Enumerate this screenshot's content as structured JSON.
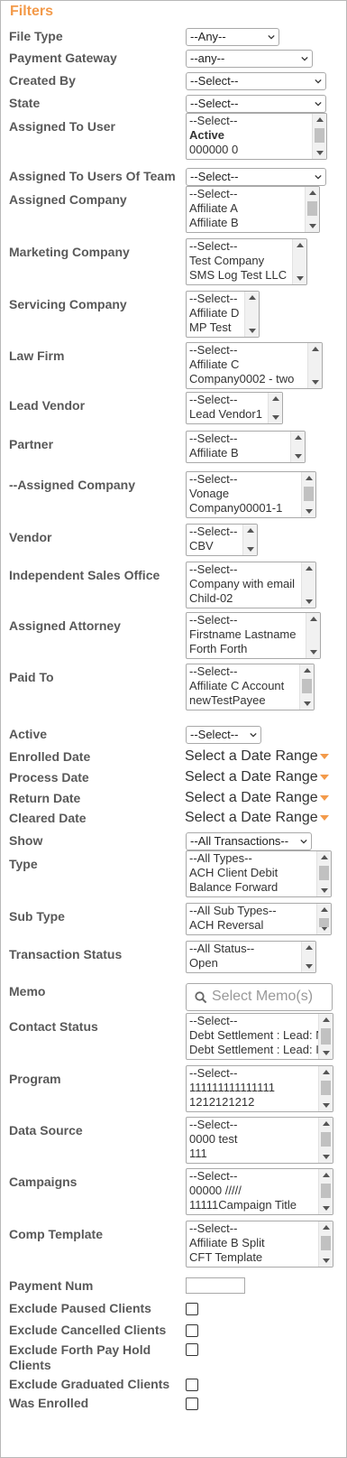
{
  "title": "Filters",
  "file_type": {
    "label": "File Type",
    "value": "--Any--"
  },
  "payment_gateway": {
    "label": "Payment Gateway",
    "value": "--any--"
  },
  "created_by": {
    "label": "Created By",
    "value": "--Select--"
  },
  "state": {
    "label": "State",
    "value": "--Select--"
  },
  "assigned_to_user": {
    "label": "Assigned To User",
    "options": [
      "--Select--",
      "Active",
      "000000  0"
    ]
  },
  "assigned_to_users_of_team": {
    "label": "Assigned To Users Of Team",
    "value": "--Select--"
  },
  "assigned_company": {
    "label": "Assigned Company",
    "options": [
      "--Select--",
      "Affiliate A",
      "Affiliate B"
    ]
  },
  "marketing_company": {
    "label": "Marketing Company",
    "options": [
      "--Select--",
      "Test Company",
      "SMS Log Test LLC"
    ]
  },
  "servicing_company": {
    "label": "Servicing Company",
    "options": [
      "--Select--",
      "Affiliate D",
      "MP Test"
    ]
  },
  "law_firm": {
    "label": "Law Firm",
    "options": [
      "--Select--",
      "Affiliate C",
      "Company0002 - two"
    ]
  },
  "lead_vendor": {
    "label": "Lead Vendor",
    "options": [
      "--Select--",
      "Lead Vendor1"
    ]
  },
  "partner": {
    "label": "Partner",
    "options": [
      "--Select--",
      "Affiliate B"
    ]
  },
  "assigned_company_2": {
    "label": "--Assigned Company",
    "options": [
      "--Select--",
      "Vonage",
      "Company00001-1"
    ]
  },
  "vendor": {
    "label": "Vendor",
    "options": [
      "--Select--",
      "CBV"
    ]
  },
  "independent_sales_office": {
    "label": "Independent Sales Office",
    "options": [
      "--Select--",
      "Company with email",
      "Child-02"
    ]
  },
  "assigned_attorney": {
    "label": "Assigned Attorney",
    "options": [
      "--Select--",
      "Firstname Lastname",
      "Forth Forth"
    ]
  },
  "paid_to": {
    "label": "Paid To",
    "options": [
      "--Select--",
      "Affiliate C Account",
      "newTestPayee"
    ]
  },
  "active": {
    "label": "Active",
    "value": "--Select--"
  },
  "enrolled_date": {
    "label": "Enrolled Date",
    "value": "Select a Date Range"
  },
  "process_date": {
    "label": "Process Date",
    "value": "Select a Date Range"
  },
  "return_date": {
    "label": "Return Date",
    "value": "Select a Date Range"
  },
  "cleared_date": {
    "label": "Cleared Date",
    "value": "Select a Date Range"
  },
  "show": {
    "label": "Show",
    "value": "--All Transactions--"
  },
  "type": {
    "label": "Type",
    "options": [
      "--All Types--",
      "ACH Client Debit",
      "Balance Forward"
    ]
  },
  "sub_type": {
    "label": "Sub Type",
    "options": [
      "--All Sub Types--",
      "ACH Reversal"
    ]
  },
  "transaction_status": {
    "label": "Transaction Status",
    "options": [
      "--All Status--",
      "Open"
    ]
  },
  "memo": {
    "label": "Memo",
    "placeholder": "Select Memo(s)"
  },
  "contact_status": {
    "label": "Contact Status",
    "options": [
      "--Select--",
      "Debt Settlement : Lead: N",
      "Debt Settlement : Lead: I"
    ]
  },
  "program": {
    "label": "Program",
    "options": [
      "--Select--",
      "111111111111111",
      "1212121212"
    ]
  },
  "data_source": {
    "label": "Data Source",
    "options": [
      "--Select--",
      "0000 test",
      "111"
    ]
  },
  "campaigns": {
    "label": "Campaigns",
    "options": [
      "--Select--",
      "00000 /////",
      "11111Campaign Title"
    ]
  },
  "comp_template": {
    "label": "Comp Template",
    "options": [
      "--Select--",
      "Affiliate B Split",
      "CFT Template"
    ]
  },
  "payment_num": {
    "label": "Payment Num",
    "value": ""
  },
  "exclude_paused": {
    "label": "Exclude Paused Clients",
    "checked": false
  },
  "exclude_cancelled": {
    "label": "Exclude Cancelled Clients",
    "checked": false
  },
  "exclude_forth_pay": {
    "label": "Exclude Forth Pay Hold Clients",
    "checked": false
  },
  "exclude_graduated": {
    "label": "Exclude Graduated Clients",
    "checked": false
  },
  "was_enrolled": {
    "label": "Was Enrolled",
    "checked": false
  },
  "colors": {
    "accent": "#f39a4a",
    "label": "#595959",
    "border": "#a9a9a9"
  }
}
